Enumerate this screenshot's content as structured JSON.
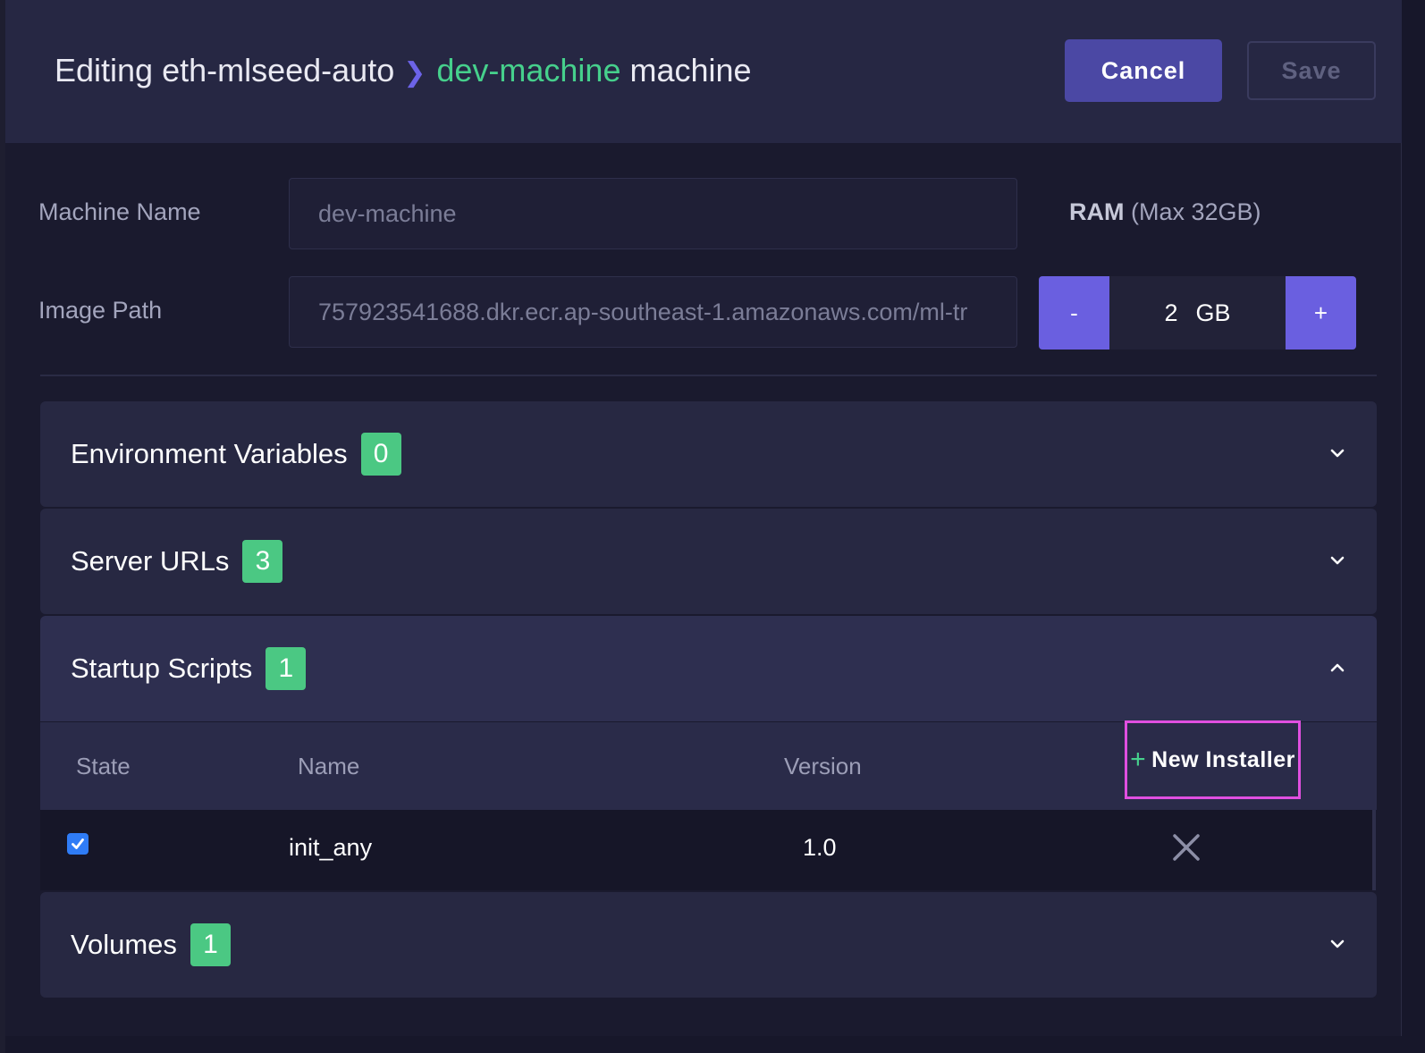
{
  "header": {
    "title_prefix": "Editing eth-mlseed-auto",
    "chevron_glyph": "❯",
    "machine_name": "dev-machine",
    "title_suffix": "machine",
    "cancel_label": "Cancel",
    "save_label": "Save"
  },
  "form": {
    "machine_name_label": "Machine Name",
    "machine_name_value": "dev-machine",
    "image_path_label": "Image Path",
    "image_path_value": "757923541688.dkr.ecr.ap-southeast-1.amazonaws.com/ml-tr",
    "ram_label": "RAM",
    "ram_max": "(Max 32GB)",
    "ram_value": "2",
    "ram_unit": "GB",
    "ram_decrement": "-",
    "ram_increment": "+"
  },
  "sections": [
    {
      "title": "Environment Variables",
      "count": "0",
      "expanded": false
    },
    {
      "title": "Server URLs",
      "count": "3",
      "expanded": false
    },
    {
      "title": "Startup Scripts",
      "count": "1",
      "expanded": true
    },
    {
      "title": "Volumes",
      "count": "1",
      "expanded": false
    }
  ],
  "startup_scripts": {
    "columns": {
      "state": "State",
      "name": "Name",
      "version": "Version"
    },
    "new_installer_plus": "+",
    "new_installer_label": "New Installer",
    "rows": [
      {
        "state": true,
        "name": "init_any",
        "version": "1.0"
      }
    ]
  },
  "colors": {
    "accent": "#6a5fe0",
    "badge": "#4bc883",
    "highlight": "#e04fe0",
    "machine_name": "#46d08c"
  }
}
